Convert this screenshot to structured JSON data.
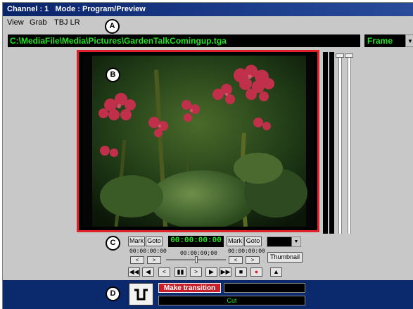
{
  "window": {
    "title": "Channel : 1   Mode : Program/Preview"
  },
  "menu": {
    "items": [
      "View",
      "Grab",
      "TBJ LR"
    ]
  },
  "path": {
    "value": "C:\\MediaFile\\Media\\Pictures\\GardenTalkComingup.tga"
  },
  "frame_select": {
    "value": "Frame"
  },
  "annotations": {
    "a": "A",
    "b": "B",
    "c": "C",
    "d": "D"
  },
  "controls": {
    "mark_left": "Mark",
    "goto_left": "Goto",
    "main_timecode": "00:00:00:00",
    "mark_right": "Mark",
    "goto_right": "Goto",
    "in_timecode": "00:00:00:00",
    "center_timecode": "00:00:00;00",
    "out_timecode": "00:00:00:00",
    "thumbnail": "Thumbnail",
    "step_back": "<",
    "step_fwd": ">",
    "transport": [
      "◀◀",
      "◀",
      "<",
      "▮▮",
      ">",
      "▶",
      "▶▶",
      "■",
      "●",
      "▲"
    ]
  },
  "transition": {
    "make_label": "Make transition",
    "status_text": "Cut"
  },
  "colors": {
    "title_bar": "#0a246a",
    "timecode_text": "#1ee81e",
    "preview_border": "#e0212a",
    "record": "#e0212a",
    "bottom_panel": "#0b2a6e"
  }
}
